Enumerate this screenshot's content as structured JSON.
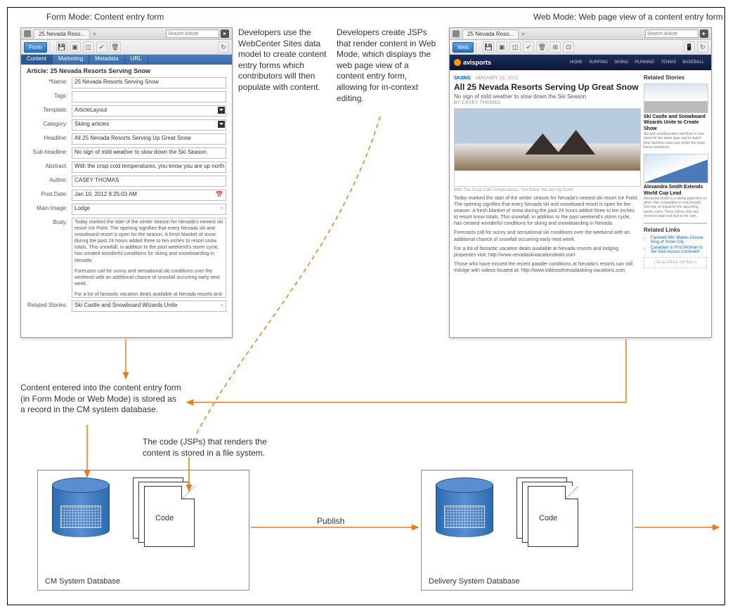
{
  "captions": {
    "formMode": "Form Mode: Content entry form",
    "webMode": "Web Mode: Web page view of a content entry form"
  },
  "annotations": {
    "developersModel": "Developers use the WebCenter Sites data model to create content entry forms which contributors will then populate with content.",
    "developersJsp": "Developers create JSPs that render content in Web Mode, which displays the web page view of a content entry form, allowing for in-context editing.",
    "storedAsRecord": "Content entered into the content entry form (in Form Mode or Web Mode) is stored as a record in the CM system database.",
    "codeStored": "The code (JSPs) that renders the content is stored in a file system."
  },
  "arrowLabels": {
    "publish": "Publish"
  },
  "app": {
    "tabTitle": "25 Nevada Reso...",
    "searchPlaceholder": "Search Article",
    "modeForm": "Form",
    "modeWeb": "Web"
  },
  "form": {
    "tabs": {
      "content": "Content",
      "marketing": "Marketing",
      "metadata": "Metadata",
      "url": "URL"
    },
    "title": "Article: 25 Nevada Resorts Serving Snow",
    "labels": {
      "name": "Name:",
      "tags": "Tags:",
      "template": "Template:",
      "category": "Category:",
      "headline": "Headline:",
      "subheadline": "Sub-headline:",
      "abstract": "Abstract:",
      "author": "Author:",
      "postdate": "Post Date:",
      "mainimage": "Main Image:",
      "body": "Body:",
      "related": "Related Stories:"
    },
    "values": {
      "name": "25 Nevada Resorts Serving Snow",
      "tags": "",
      "template": "ArticleLayout",
      "category": "Skiing articles",
      "headline": "All 25 Nevada Resorts Serving Up Great Snow",
      "subheadline": "No sign of mild weather to slow down the Ski Season",
      "abstract": "With the crisp cold temperatures, you know you are up north and n",
      "author": "CASEY THOMAS",
      "postdate": "Jan 10, 2012 9:25:03 AM",
      "mainimage": "Lodge",
      "body_p1": "Today marked the start of the winter season for Nevada's newest ski resort Ice Point. The opening signifies that every Nevada ski and snowboard resort is open for the season. A fresh blanket of snow during the past 24 hours added three to ten inches to resort snow totals. This snowfall, in addition to the past weekend's storm cycle, has created wonderful conditions for skiing and snowboarding in Nevada.",
      "body_p2": "Forecasts call for sunny and sensational ski conditions over the weekend with an additional chance of snowfall occurring early next week.",
      "body_p3": "For a list of fantastic vacation deals available at Nevada resorts and lodging properties visit: http://www.nevadaskivacationdeals.com",
      "body_p4": "Those who have missed the recent powder conditions at Nevada's resorts can still",
      "related": "Ski Castle and Snowboard Wizards Unite"
    }
  },
  "web": {
    "siteName": "avisports",
    "nav": {
      "home": "HOME",
      "surfing": "SURFING",
      "skiing": "SKIING",
      "running": "RUNNING",
      "tennis": "TENNIS",
      "baseball": "BASEBALL"
    },
    "category": "SKIING",
    "date": "JANUARY 10, 2012",
    "headline": "All 25 Nevada Resorts Serving Up Great Snow",
    "subheadline": "No sign of mild weather to slow down the Ski Season",
    "byline": "BY CASEY THOMAS",
    "heroCaption": "With The Crisp Cold Temperatures, You Know You Are Up North",
    "p1": "Today marked the start of the winter season for Nevada's newest ski resort Ice Point. The opening signifies that every Nevada ski and snowboard resort is open for the season. A fresh blanket of snow during the past 24 hours added three to ten inches to resort snow totals. This snowfall, in addition to the past weekend's storm cycle, has created wonderful conditions for skiing and snowboarding in Nevada.",
    "p2": "Forecasts call for sunny and sensational ski conditions over the weekend with an additional chance of snowfall occurring early next week.",
    "p3": "For a list of fantastic vacation deals available at Nevada resorts and lodging properties visit: http://www.nevadaskivacationdeals.com",
    "p4": "Those who have missed the recent powder conditions at Nevada's resorts can still indulge with videos located at: http://www.videosofnevadaskiing-vacations.com.",
    "side": {
      "relatedStories": "Related Stories",
      "story1_title": "Ski Castle and Snowboard Wizards Unite to Create Show",
      "story1_text": "Ski and snowboarders will flock to new show for the latest gear and to watch their favorites take runs under the most fierce conditions.",
      "story2_title": "Alexandra Smith Extends World Cup Lead",
      "story2_text": "Alexandra Smith is a skiing talent like no other. Her competition is only herself. She has no equal for the upcoming winter event. There will be only one record to beat and that is her own.",
      "relatedLinks": "Related Links",
      "link1": "Farewell Win Makes Crosse King of Snow City",
      "link2": "Canadian is First Woman to Ski Solo Across Continent",
      "drop": "[ Drop Article #3 Here ]"
    }
  },
  "systems": {
    "cm": "CM System Database",
    "delivery": "Delivery System Database",
    "code": "Code"
  }
}
